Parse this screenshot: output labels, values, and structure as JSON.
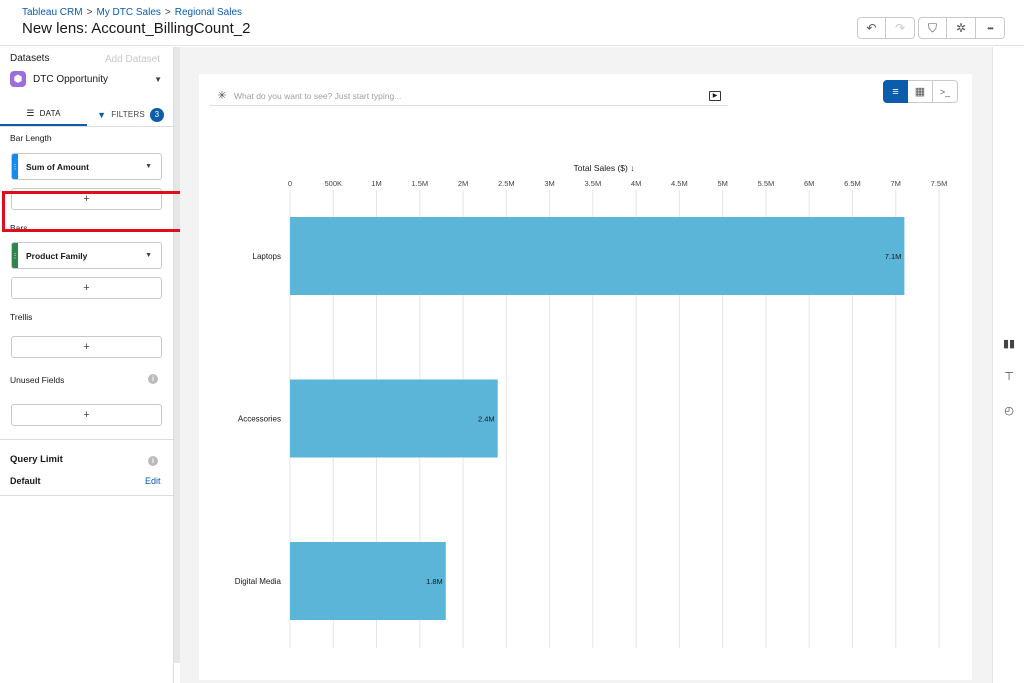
{
  "header": {
    "breadcrumb": [
      "Tableau CRM",
      "My DTC Sales",
      "Regional Sales"
    ],
    "breadcrumb_sep": ">",
    "title": "New lens: Account_BillingCount_2",
    "toolbar": [
      {
        "icon": "undo-icon",
        "glyph": "↶",
        "disabled": false
      },
      {
        "icon": "redo-icon",
        "glyph": "↷",
        "disabled": true
      },
      {
        "icon": "save-icon",
        "glyph": "⛉",
        "disabled": false
      },
      {
        "icon": "settings-icon",
        "glyph": "✲",
        "disabled": false
      },
      {
        "icon": "more-icon",
        "glyph": "•••",
        "disabled": false
      }
    ]
  },
  "left_panel": {
    "datasets_label": "Datasets",
    "add_dataset_label": "Add Dataset",
    "dataset_name": "DTC Opportunity",
    "tabs": {
      "data_label": "DATA",
      "filters_label": "FILTERS",
      "filters_count": "3"
    },
    "bar_length_label": "Bar Length",
    "bar_length_field": "Sum of Amount",
    "bars_label": "Bars",
    "bars_field": "Product Family",
    "trellis_label": "Trellis",
    "unused_fields_label": "Unused Fields",
    "add_glyph": "+",
    "query_limit_label": "Query Limit",
    "query_limit_value": "Default",
    "edit_label": "Edit",
    "colors": {
      "measure": "#1589ee",
      "dimension": "#2e844a",
      "highlight": "#e00d1a"
    }
  },
  "main": {
    "search_placeholder": "What do you want to see? Just start typing..."
  },
  "chart_data": {
    "type": "bar",
    "orientation": "horizontal",
    "title": "Total Sales ($) ↓",
    "categories": [
      "Laptops",
      "Accessories",
      "Digital Media"
    ],
    "values": [
      7100000,
      2400000,
      1800000
    ],
    "data_labels": [
      "7.1M",
      "2.4M",
      "1.8M"
    ],
    "xlim": [
      0,
      7500000
    ],
    "tick_values": [
      0,
      500000,
      1000000,
      1500000,
      2000000,
      2500000,
      3000000,
      3500000,
      4000000,
      4500000,
      5000000,
      5500000,
      6000000,
      6500000,
      7000000,
      7500000
    ],
    "tick_labels": [
      "0",
      "500K",
      "1M",
      "1.5M",
      "2M",
      "2.5M",
      "3M",
      "3.5M",
      "4M",
      "4.5M",
      "5M",
      "5.5M",
      "6M",
      "6.5M",
      "7M",
      "7.5M"
    ],
    "grid": true,
    "bar_color": "#5ab5d8"
  }
}
